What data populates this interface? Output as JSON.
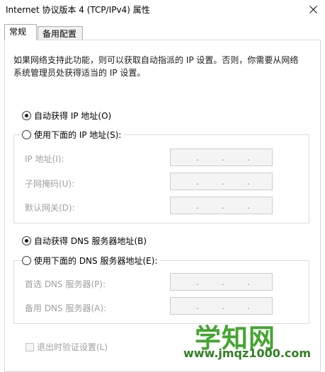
{
  "window": {
    "title": "Internet 协议版本 4 (TCP/IPv4) 属性"
  },
  "tabs": [
    {
      "label": "常规",
      "active": true
    },
    {
      "label": "备用配置",
      "active": false
    }
  ],
  "intro_text": "如果网络支持此功能，则可以获取自动指派的 IP 设置。否则，你需要从网络系统管理员处获得适当的 IP 设置。",
  "ip_section": {
    "auto_option": {
      "label": "自动获得 IP 地址(O)",
      "selected": true
    },
    "manual_option": {
      "label": "使用下面的 IP 地址(S):",
      "selected": false
    },
    "fields": [
      {
        "label": "IP 地址(I):",
        "value": ".   .   ."
      },
      {
        "label": "子网掩码(U):",
        "value": ".   .   ."
      },
      {
        "label": "默认网关(D):",
        "value": ".   .   ."
      }
    ]
  },
  "dns_section": {
    "auto_option": {
      "label": "自动获得 DNS 服务器地址(B)",
      "selected": true
    },
    "manual_option": {
      "label": "使用下面的 DNS 服务器地址(E):",
      "selected": false
    },
    "fields": [
      {
        "label": "首选 DNS 服务器(P):",
        "value": ".   .   ."
      },
      {
        "label": "备用 DNS 服务器(A):",
        "value": ".   .   ."
      }
    ]
  },
  "validate_on_exit": {
    "label": "退出时验证设置(L)",
    "checked": false,
    "enabled": false
  },
  "watermark": {
    "text": "学知网",
    "url": "www.jmqz1000.com",
    "color": "#44a530"
  },
  "icons": {
    "close": "close-icon"
  }
}
